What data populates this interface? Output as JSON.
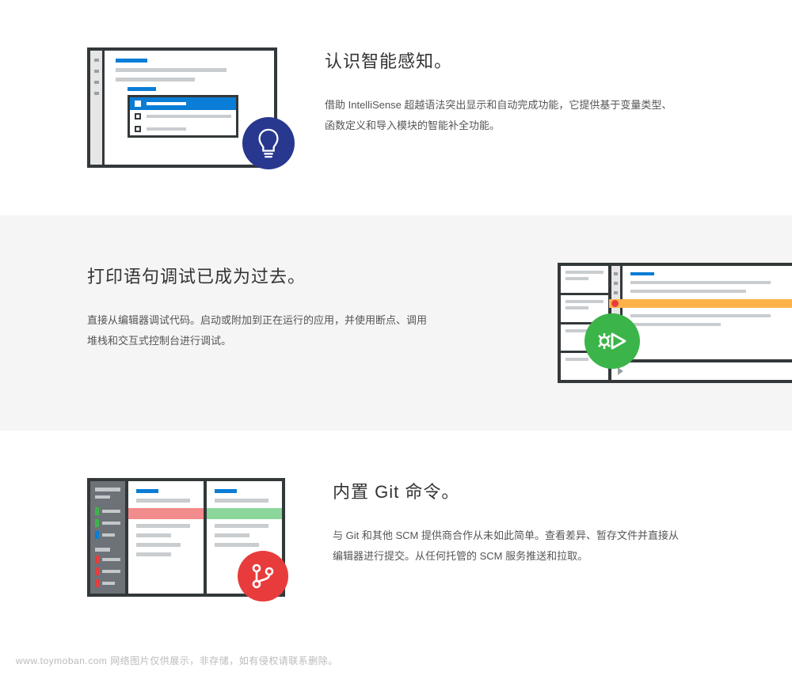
{
  "sections": {
    "intellisense": {
      "heading": "认识智能感知。",
      "body": "借助 IntelliSense 超越语法突出显示和自动完成功能，它提供基于变量类型、函数定义和导入模块的智能补全功能。"
    },
    "debug": {
      "heading": "打印语句调试已成为过去。",
      "body": "直接从编辑器调试代码。启动或附加到正在运行的应用，并使用断点、调用堆栈和交互式控制台进行调试。"
    },
    "git": {
      "heading": "内置 Git 命令。",
      "body": "与 Git 和其他 SCM 提供商合作从未如此简单。查看差异、暂存文件并直接从编辑器进行提交。从任何托管的 SCM 服务推送和拉取。"
    }
  },
  "footer": "www.toymoban.com 网络图片仅供展示，非存储，如有侵权请联系删除。"
}
